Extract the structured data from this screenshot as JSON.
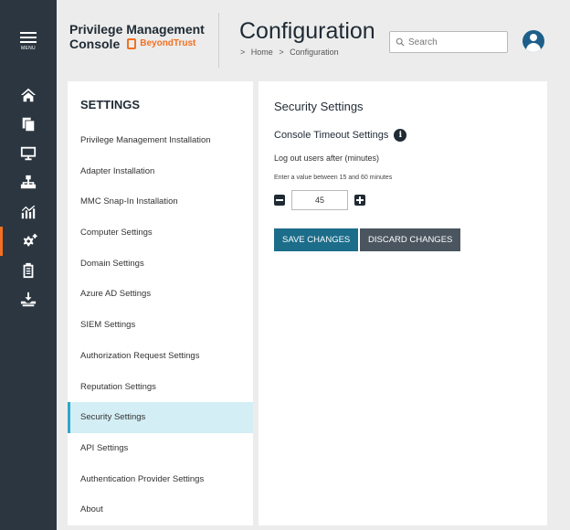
{
  "rail": {
    "menu_label": "MENU",
    "items": [
      {
        "icon": "home-icon"
      },
      {
        "icon": "policy-icon"
      },
      {
        "icon": "computer-icon"
      },
      {
        "icon": "network-icon"
      },
      {
        "icon": "analytics-icon"
      },
      {
        "icon": "settings-gears-icon",
        "active": true
      },
      {
        "icon": "clipboard-icon"
      },
      {
        "icon": "download-icon"
      }
    ],
    "accent": "#f37021"
  },
  "header": {
    "app_title_line1": "Privilege Management",
    "app_title_line2": "Console",
    "brand": "BeyondTrust",
    "page_title": "Configuration",
    "breadcrumb": [
      ">",
      "Home",
      ">",
      "Configuration"
    ],
    "search_placeholder": "Search"
  },
  "settings": {
    "heading": "SETTINGS",
    "items": [
      "Privilege Management Installation",
      "Adapter Installation",
      "MMC Snap-In Installation",
      "Computer Settings",
      "Domain Settings",
      "Azure AD Settings",
      "SIEM Settings",
      "Authorization Request Settings",
      "Reputation Settings",
      "Security Settings",
      "API Settings",
      "Authentication Provider Settings",
      "About"
    ],
    "active_index": 9
  },
  "security": {
    "title": "Security Settings",
    "subtitle": "Console Timeout Settings",
    "field_label": "Log out users after (minutes)",
    "hint": "Enter a value between 15 and 60 minutes",
    "timeout_value": "45",
    "save_label": "SAVE CHANGES",
    "discard_label": "DISCARD CHANGES",
    "save_color": "#1c6d8a",
    "discard_color": "#4a555f"
  }
}
